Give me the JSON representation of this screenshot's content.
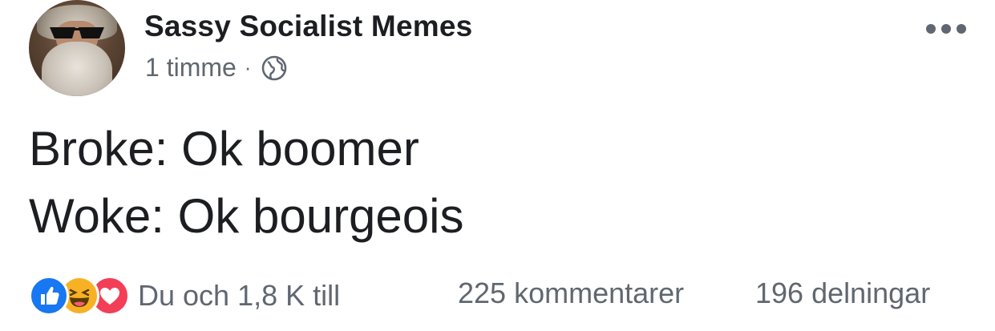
{
  "post": {
    "author": "Sassy Socialist Memes",
    "timestamp": "1 timme",
    "separator": "·",
    "privacy_icon": "globe-icon",
    "menu_icon": "more-options-icon",
    "text_line1": "Broke: Ok boomer",
    "text_line2": "Woke: Ok bourgeois"
  },
  "footer": {
    "reactions": [
      "like-reaction-icon",
      "haha-reaction-icon",
      "love-reaction-icon"
    ],
    "reaction_summary": "Du och 1,8 K till",
    "comments": "225 kommentarer",
    "shares": "196 delningar"
  },
  "colors": {
    "text": "#1c1e21",
    "secondary": "#606770",
    "like": "#1877f2",
    "haha": "#f7b125",
    "love": "#f33e58"
  }
}
